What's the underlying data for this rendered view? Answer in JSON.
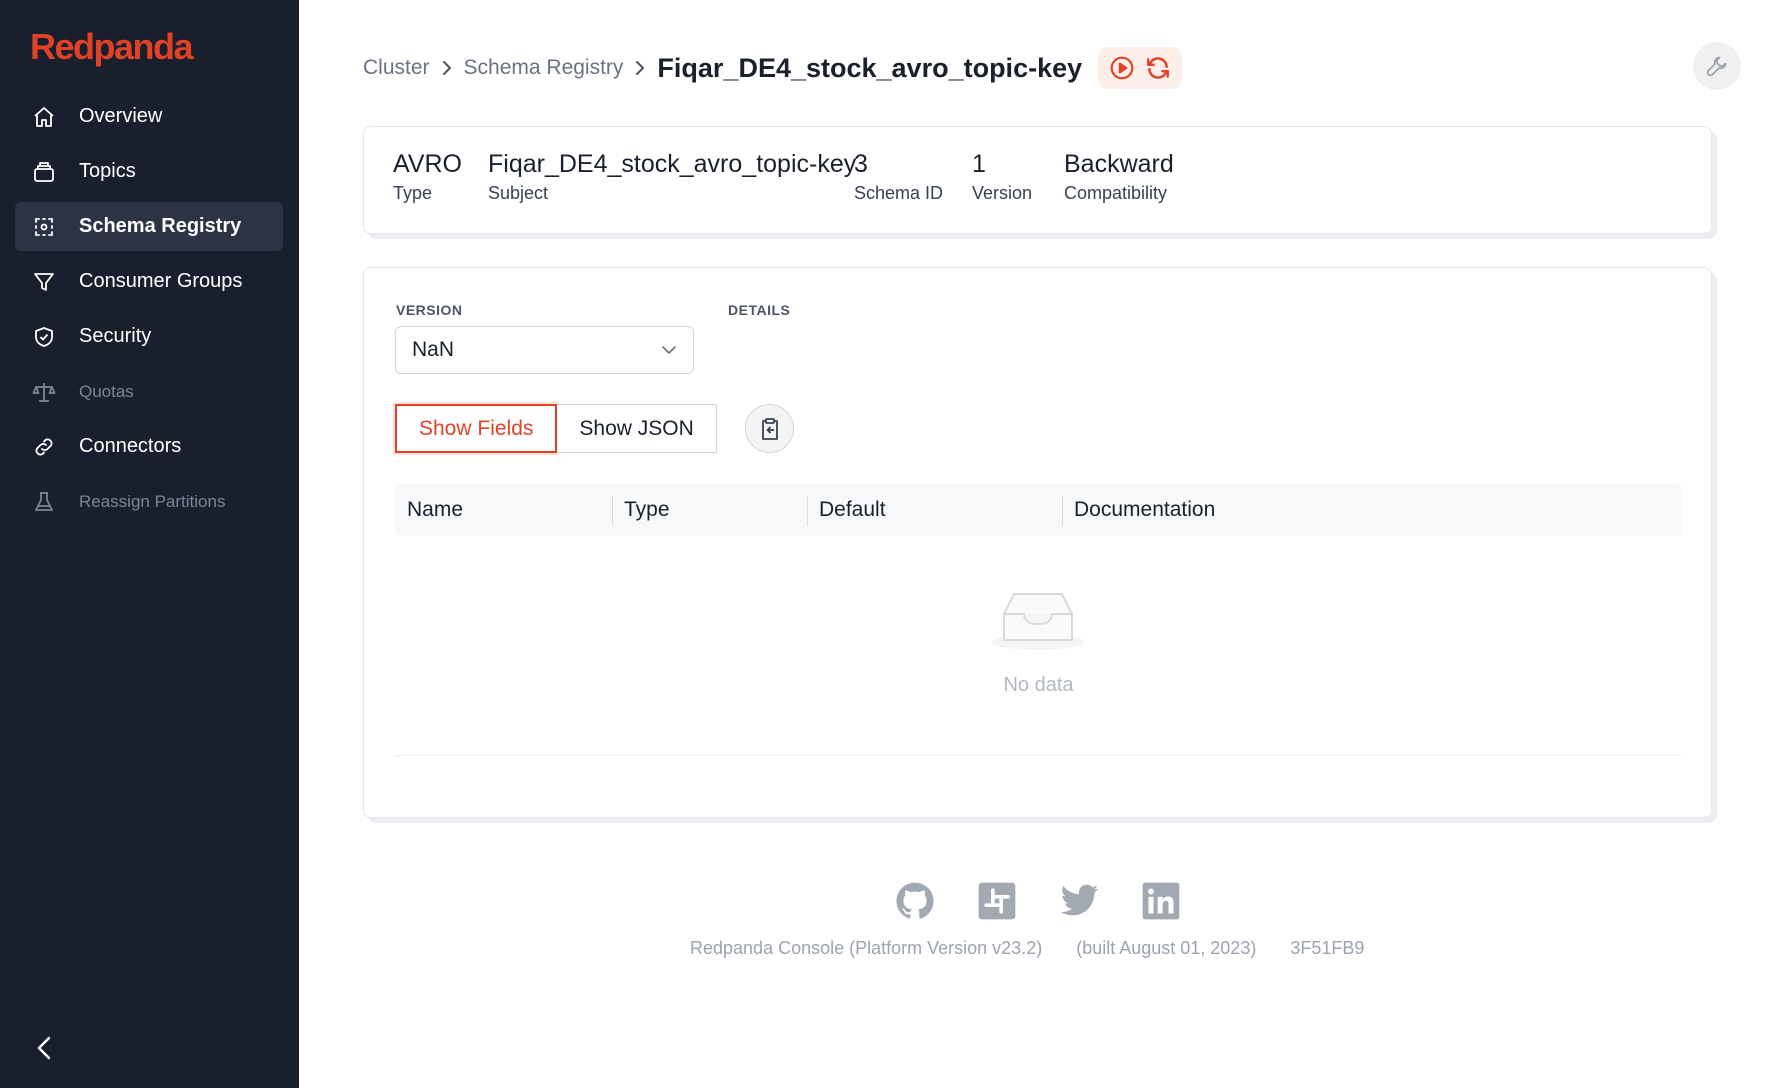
{
  "app": {
    "logo": "Redpanda",
    "accent": "#e14226",
    "sidebar_bg": "#1a1f2e"
  },
  "sidebar": {
    "items": [
      {
        "label": "Overview",
        "icon": "home-icon",
        "state": "normal"
      },
      {
        "label": "Topics",
        "icon": "topics-icon",
        "state": "normal"
      },
      {
        "label": "Schema Registry",
        "icon": "schema-icon",
        "state": "active"
      },
      {
        "label": "Consumer Groups",
        "icon": "filter-icon",
        "state": "normal"
      },
      {
        "label": "Security",
        "icon": "shield-icon",
        "state": "normal"
      },
      {
        "label": "Quotas",
        "icon": "scale-icon",
        "state": "disabled"
      },
      {
        "label": "Connectors",
        "icon": "link-icon",
        "state": "normal"
      },
      {
        "label": "Reassign Partitions",
        "icon": "beaker-icon",
        "state": "disabled"
      }
    ],
    "collapse_icon": "chevron-left-icon"
  },
  "breadcrumb": {
    "items": [
      "Cluster",
      "Schema Registry"
    ],
    "current": "Fiqar_DE4_stock_avro_topic-key"
  },
  "summary": {
    "type_value": "AVRO",
    "type_label": "Type",
    "subject_value": "Fiqar_DE4_stock_avro_topic-key",
    "subject_label": "Subject",
    "schema_id_value": "3",
    "schema_id_label": "Schema ID",
    "version_value": "1",
    "version_label": "Version",
    "compat_value": "Backward",
    "compat_label": "Compatibility"
  },
  "schema": {
    "version_label": "VERSION",
    "details_label": "DETAILS",
    "version_selected": "NaN",
    "show_fields": "Show Fields",
    "show_json": "Show JSON",
    "columns": [
      "Name",
      "Type",
      "Default",
      "Documentation"
    ],
    "empty_text": "No data"
  },
  "footer": {
    "platform": "Redpanda Console (Platform Version v23.2)",
    "built": "(built August 01, 2023)",
    "commit": "3F51FB9",
    "socials": [
      "github-icon",
      "slack-icon",
      "twitter-icon",
      "linkedin-icon"
    ]
  }
}
